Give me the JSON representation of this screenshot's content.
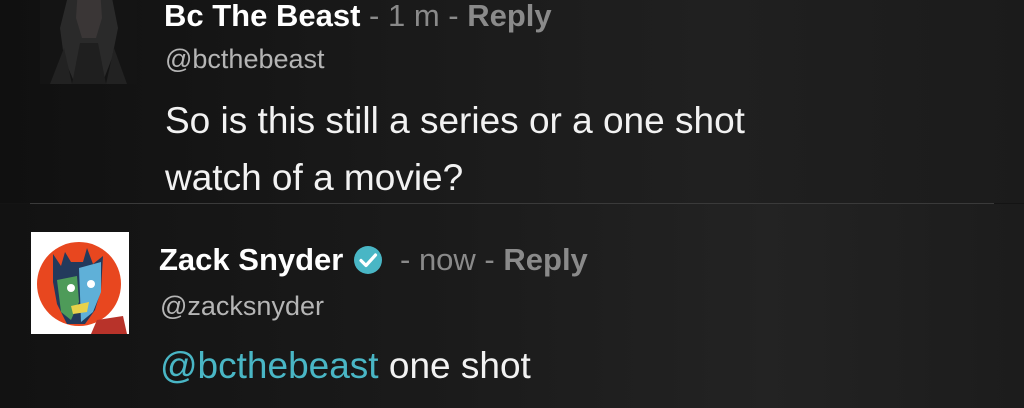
{
  "comments": [
    {
      "name": "Bc The Beast",
      "separator1": " - ",
      "time": "1 m",
      "separator2": " - ",
      "reply_label": "Reply",
      "handle": "@bcthebeast",
      "body_line1": "So is this still a series or a one shot",
      "body_line2": "watch of a movie?"
    },
    {
      "name": "Zack Snyder",
      "verified": true,
      "separator1": " - ",
      "time": "now",
      "separator2": " - ",
      "reply_label": "Reply",
      "handle": "@zacksnyder",
      "mention": "@bcthebeast",
      "body_rest": " one shot"
    }
  ],
  "colors": {
    "background": "#141414",
    "meta_gray": "#8a8a8a",
    "mention_teal": "#49b6c5",
    "verified_blue": "#49b6c5"
  },
  "icons": [
    "verified-badge-icon"
  ]
}
